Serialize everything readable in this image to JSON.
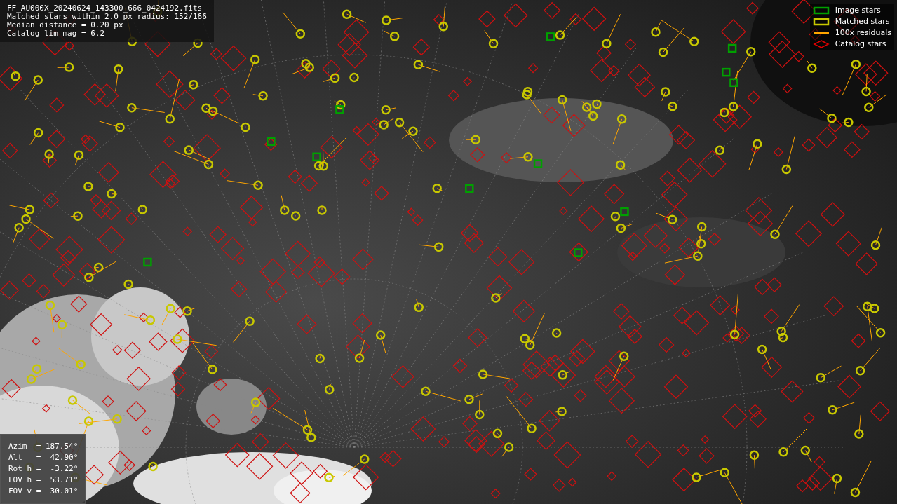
{
  "info_box": {
    "lines": [
      "FF_AU000X_20240624_143300_666_0424192.fits",
      "Matched stars within 2.0 px radius: 152/166",
      "Median distance = 0.20 px",
      "Catalog lim mag = 6.2"
    ]
  },
  "legend": [
    {
      "label": "Image stars",
      "color": "#00a000"
    },
    {
      "kind": "matched",
      "label": "Matched stars",
      "color": "#c8c800"
    },
    {
      "kind": "residual",
      "label": "100x residuals",
      "color": "#ffa500"
    },
    {
      "kind": "catalog",
      "label": "Catalog stars",
      "color": "#e00000"
    }
  ],
  "orientation_box": {
    "lines": [
      "Azim  = 187.54°",
      "Alt   =  42.90°",
      "Rot h =  -3.22°",
      "FOV h =  53.71°",
      "FOV v =  30.01°"
    ]
  }
}
